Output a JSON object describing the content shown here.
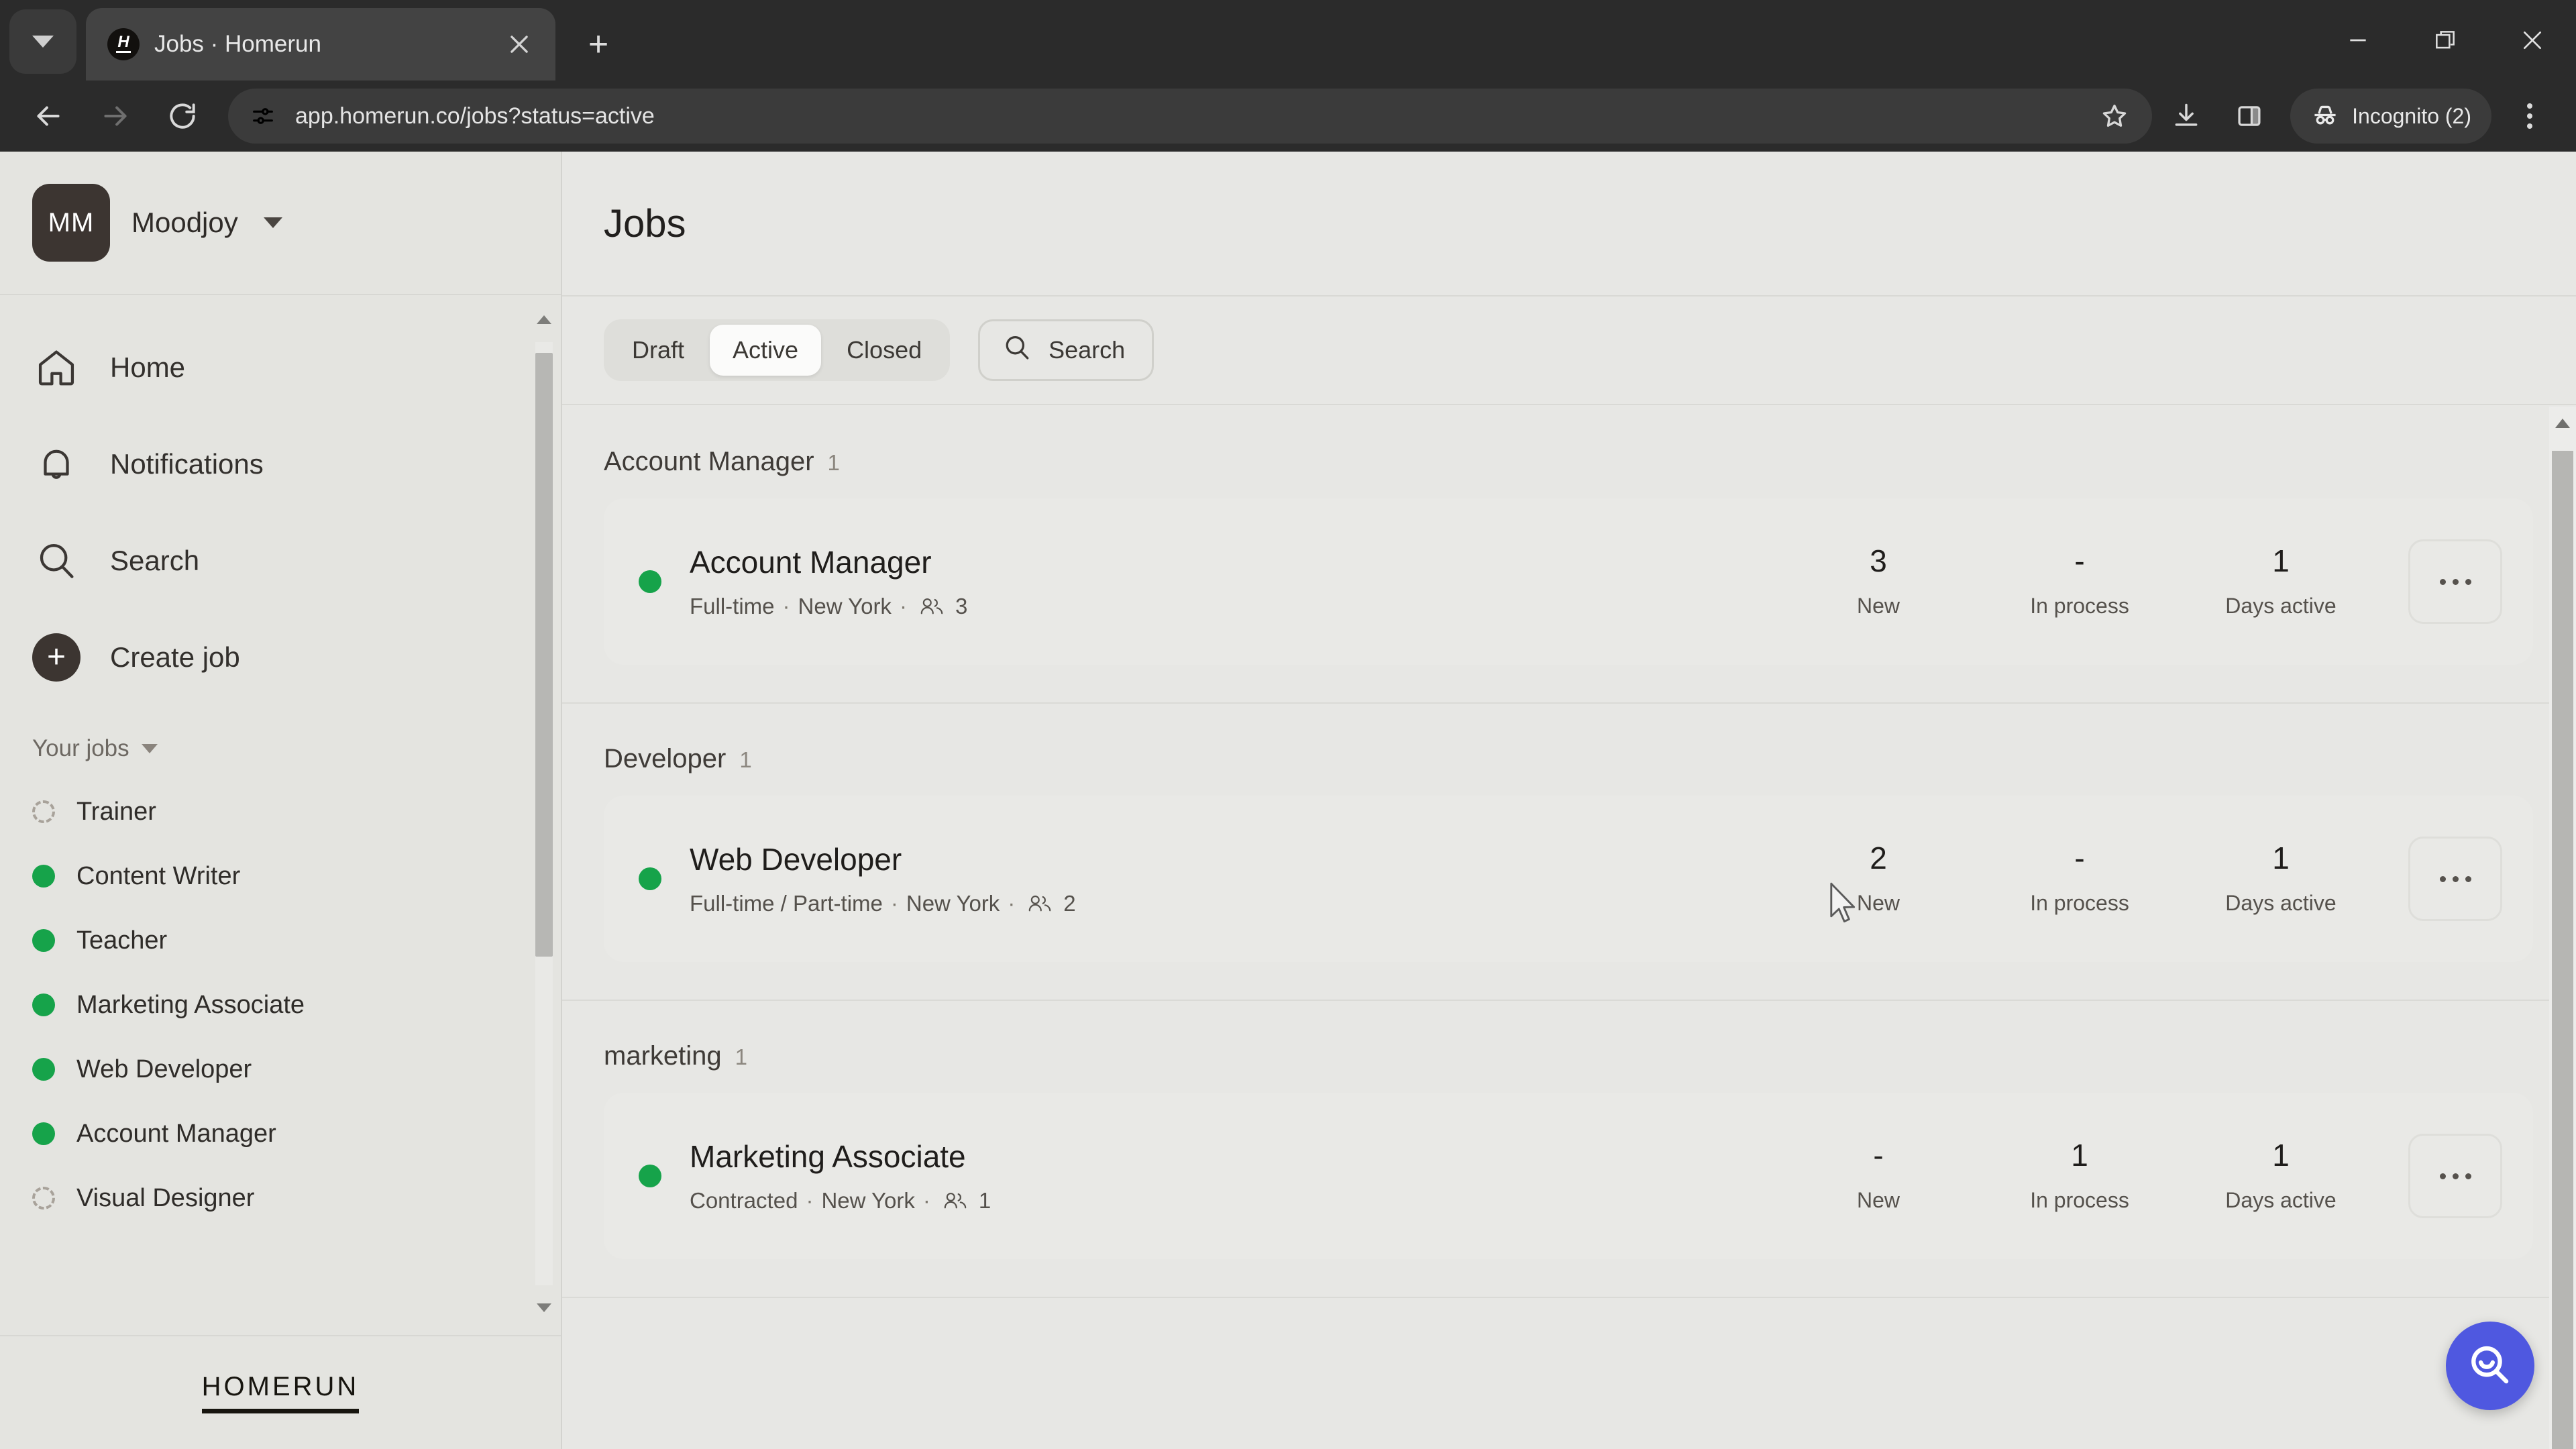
{
  "browser": {
    "tab_list_icon": "chevron-down-icon",
    "tab": {
      "title": "Jobs · Homerun",
      "favicon": "homerun-favicon",
      "close_icon": "close-icon"
    },
    "new_tab_label": "+",
    "url": "app.homerun.co/jobs?status=active",
    "site_info_icon": "site-settings-icon",
    "icons": {
      "back": "back-arrow-icon",
      "forward": "forward-arrow-icon",
      "reload": "reload-icon",
      "bookmark": "star-icon",
      "download": "download-icon",
      "side_panel": "side-panel-icon",
      "menu": "kebab-menu-icon"
    },
    "incognito_label": "Incognito (2)",
    "window_controls": {
      "minimize": "minimize-icon",
      "maximize": "restore-icon",
      "close": "window-close-icon"
    }
  },
  "sidebar": {
    "org": {
      "initials": "MM",
      "name": "Moodjoy",
      "caret": "chevron-down-icon"
    },
    "nav": [
      {
        "label": "Home",
        "icon": "home-icon"
      },
      {
        "label": "Notifications",
        "icon": "bell-icon"
      },
      {
        "label": "Search",
        "icon": "search-icon"
      },
      {
        "label": "Create job",
        "icon": "plus-circle-icon"
      }
    ],
    "your_jobs_label": "Your jobs",
    "jobs": [
      {
        "label": "Trainer",
        "status": "draft"
      },
      {
        "label": "Content Writer",
        "status": "active"
      },
      {
        "label": "Teacher",
        "status": "active"
      },
      {
        "label": "Marketing Associate",
        "status": "active"
      },
      {
        "label": "Web Developer",
        "status": "active"
      },
      {
        "label": "Account Manager",
        "status": "active"
      },
      {
        "label": "Visual Designer",
        "status": "draft"
      }
    ],
    "brand": "HOMERUN"
  },
  "main": {
    "title": "Jobs",
    "filters": [
      {
        "label": "Draft",
        "selected": false
      },
      {
        "label": "Active",
        "selected": true
      },
      {
        "label": "Closed",
        "selected": false
      }
    ],
    "search": {
      "label": "Search",
      "icon": "search-icon"
    },
    "stat_labels": {
      "new": "New",
      "in_process": "In process",
      "days_active": "Days active"
    },
    "more_icon": "ellipsis-icon",
    "groups": [
      {
        "name": "Account Manager",
        "count": "1",
        "cards": [
          {
            "title": "Account Manager",
            "status": "active",
            "employment": "Full-time",
            "location": "New York",
            "people_icon": "people-icon",
            "people": "3",
            "new": "3",
            "in_process": "-",
            "days_active": "1"
          }
        ]
      },
      {
        "name": "Developer",
        "count": "1",
        "cards": [
          {
            "title": "Web Developer",
            "status": "active",
            "employment": "Full-time / Part-time",
            "location": "New York",
            "people_icon": "people-icon",
            "people": "2",
            "new": "2",
            "in_process": "-",
            "days_active": "1"
          }
        ]
      },
      {
        "name": "marketing",
        "count": "1",
        "cards": [
          {
            "title": "Marketing Associate",
            "status": "active",
            "employment": "Contracted",
            "location": "New York",
            "people_icon": "people-icon",
            "people": "1",
            "new": "-",
            "in_process": "1",
            "days_active": "1"
          }
        ]
      }
    ],
    "fab": {
      "icon": "help-search-icon",
      "color": "#4f58e0"
    }
  },
  "colors": {
    "accent_green": "#16a34a",
    "fab_blue": "#4f58e0",
    "page_bg": "#e7e7e4",
    "sidebar_bg": "#e4e4e0",
    "chrome_bg": "#2b2b2b"
  }
}
